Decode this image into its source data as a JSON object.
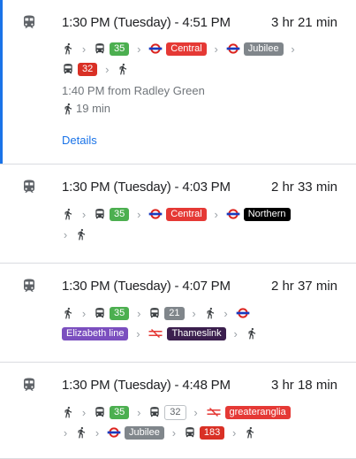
{
  "routes": [
    {
      "times": "1:30 PM (Tuesday) - 4:51 PM",
      "duration": "3 hr 21 min",
      "departure": "1:40 PM from Radley Green",
      "walk_time": "19 min",
      "details_label": "Details",
      "badges": {
        "bus": "35",
        "line1": "Central",
        "line2": "Jubilee",
        "bus2": "32"
      }
    },
    {
      "times": "1:30 PM (Tuesday) - 4:03 PM",
      "duration": "2 hr 33 min",
      "badges": {
        "bus": "35",
        "line1": "Central",
        "line2": "Northern"
      }
    },
    {
      "times": "1:30 PM (Tuesday) - 4:07 PM",
      "duration": "2 hr 37 min",
      "badges": {
        "bus": "35",
        "bus2": "21",
        "line1": "Elizabeth line",
        "line2": "Thameslink"
      }
    },
    {
      "times": "1:30 PM (Tuesday) - 4:48 PM",
      "duration": "3 hr 18 min",
      "badges": {
        "bus": "35",
        "bus2": "32",
        "line1": "greateranglia",
        "line2": "Jubilee",
        "bus3": "183"
      }
    }
  ],
  "colors": {
    "accent": "#1a73e8",
    "bus_green": "#4caf50",
    "central_red": "#e53935",
    "jubilee_grey": "#80868b",
    "northern_black": "#000000",
    "bus_red": "#d93025",
    "elizabeth_purple": "#7b4fbf",
    "thameslink_dark": "#3b1f4e",
    "tube_blue": "#1a3bbf"
  }
}
